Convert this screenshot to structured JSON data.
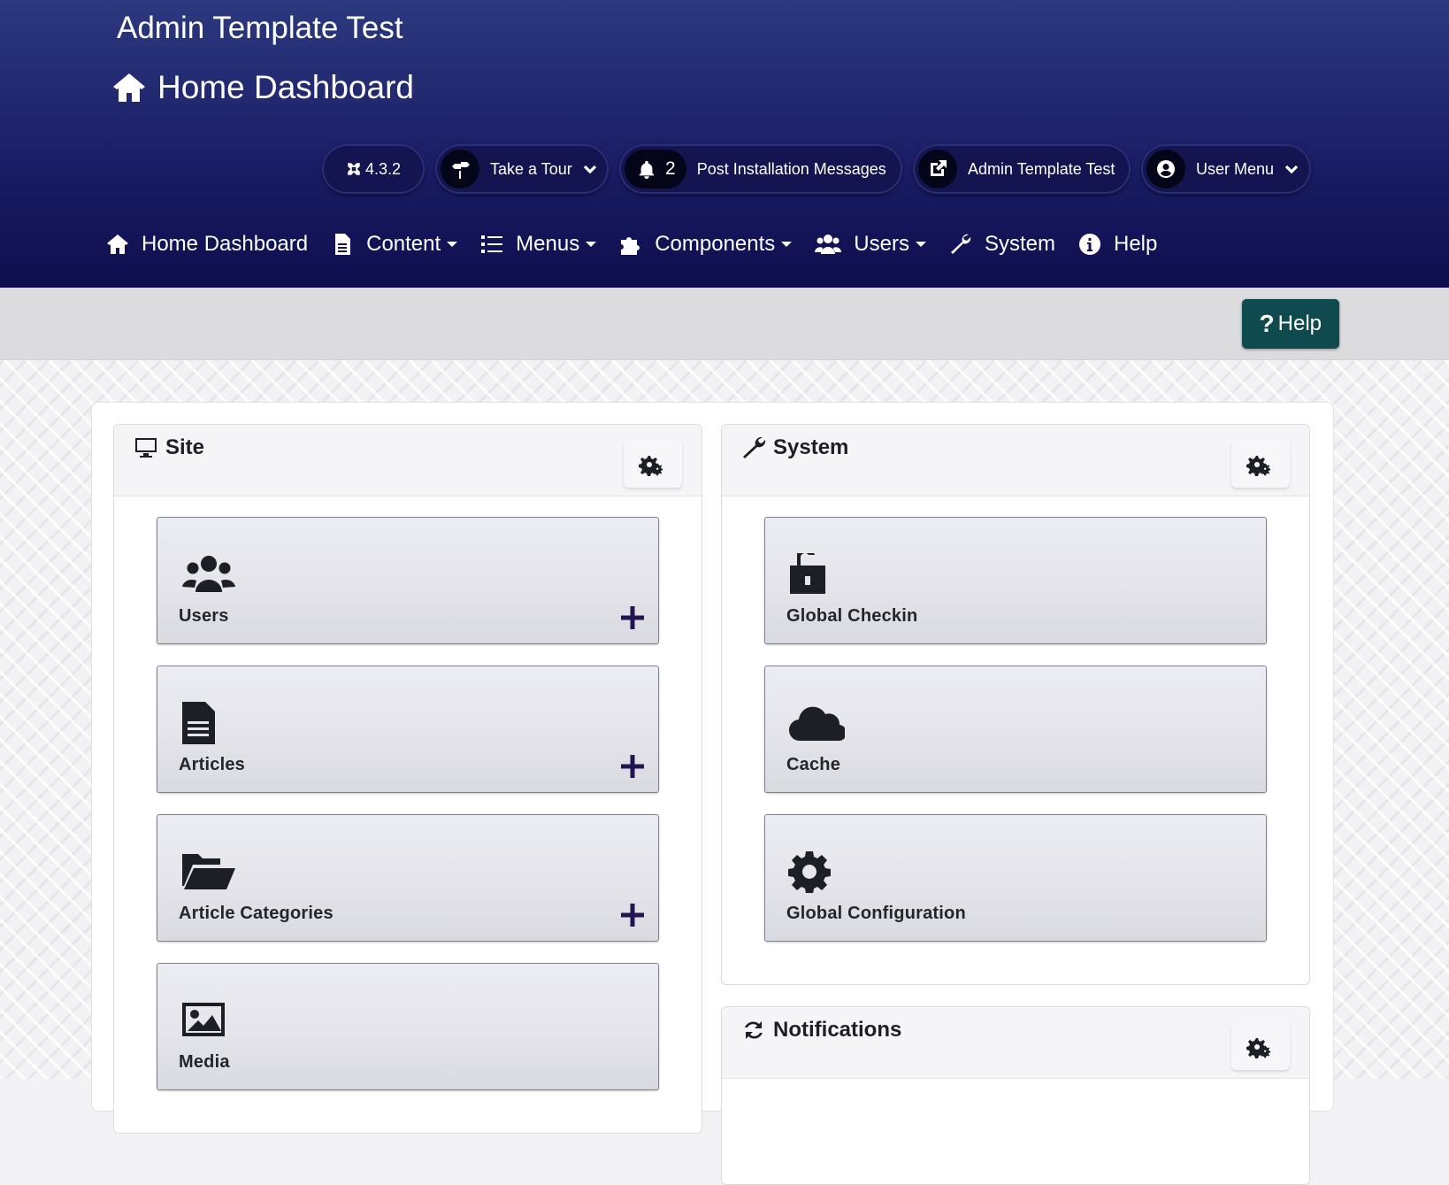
{
  "header": {
    "site_title": "Admin Template Test",
    "page_title": "Home Dashboard",
    "pills": {
      "version": "4.3.2",
      "tour_label": "Take a Tour",
      "post_install_count": "2",
      "post_install_label": "Post Installation Messages",
      "site_link_label": "Admin Template Test",
      "user_menu_label": "User Menu"
    }
  },
  "nav": {
    "home": "Home Dashboard",
    "content": "Content",
    "menus": "Menus",
    "components": "Components",
    "users": "Users",
    "system": "System",
    "help": "Help"
  },
  "toolbar": {
    "help_label": "Help"
  },
  "cards": {
    "site": {
      "title": "Site",
      "tiles": {
        "users": "Users",
        "articles": "Articles",
        "categories": "Article Categories",
        "media": "Media"
      }
    },
    "system": {
      "title": "System",
      "tiles": {
        "checkin": "Global Checkin",
        "cache": "Cache",
        "config": "Global Configuration"
      }
    },
    "notifications": {
      "title": "Notifications"
    }
  },
  "colors": {
    "header_top": "#2c397f",
    "header_bottom": "#0e0d4d",
    "help_button": "#0f4b4e",
    "plus_icon": "#23154f"
  }
}
